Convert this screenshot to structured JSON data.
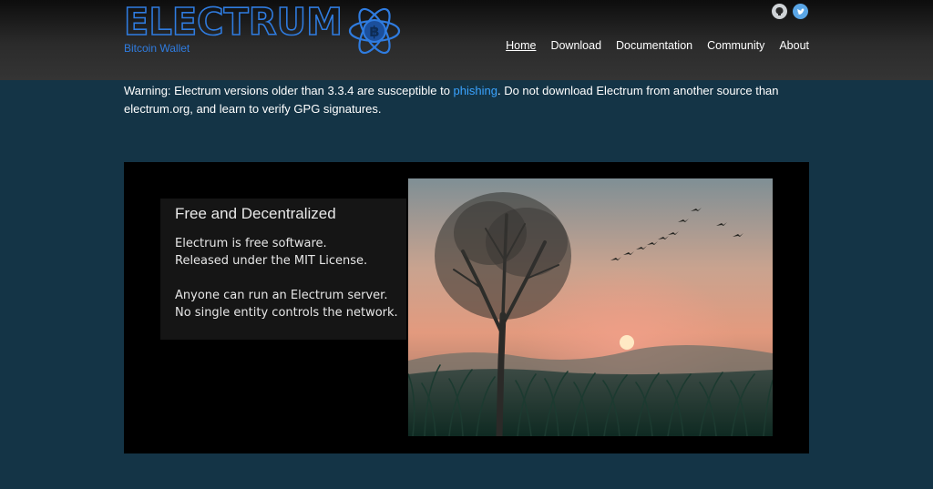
{
  "brand": {
    "name": "ELECTRUM",
    "tagline": "Bitcoin Wallet",
    "accent_color": "#2f7ce0",
    "atom_icon": "bitcoin-atom-icon"
  },
  "social": [
    {
      "name": "github",
      "icon": "github-icon"
    },
    {
      "name": "twitter",
      "icon": "twitter-icon"
    }
  ],
  "nav": {
    "items": [
      {
        "label": "Home",
        "active": true
      },
      {
        "label": "Download"
      },
      {
        "label": "Documentation"
      },
      {
        "label": "Community"
      },
      {
        "label": "About"
      }
    ]
  },
  "warning": {
    "before": "Warning: Electrum versions older than 3.3.4 are susceptible to ",
    "link": "phishing",
    "after": ". Do not download Electrum from another source than electrum.org, and learn to verify GPG signatures.",
    "link_color": "#3aa3ff"
  },
  "feature": {
    "title": "Free and Decentralized",
    "lines": [
      "Electrum is free software.",
      "Released under the MIT License.",
      "",
      "Anyone can run an Electrum server.",
      "No single entity controls the network."
    ]
  }
}
